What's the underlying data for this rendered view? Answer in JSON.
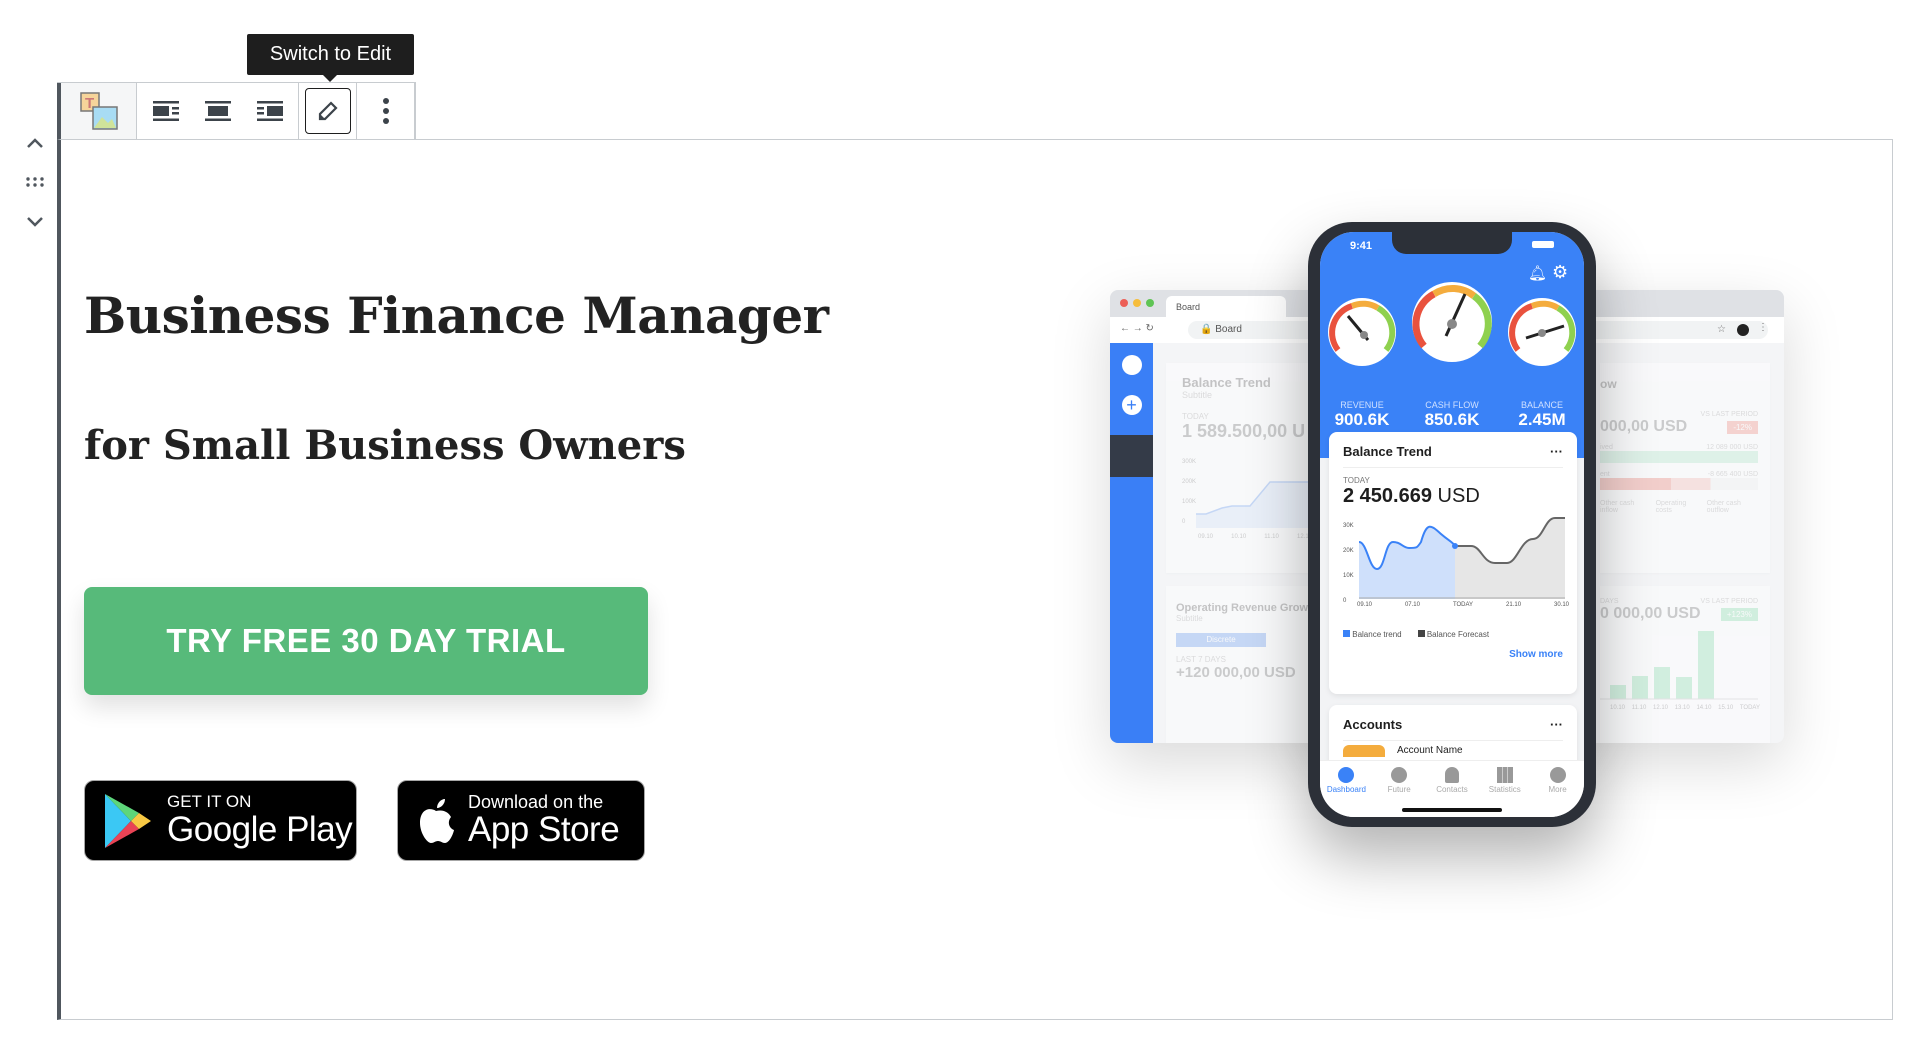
{
  "tooltip": "Switch to Edit",
  "toolbar": {
    "block_type": "media-text-icon",
    "buttons": [
      "Show media on left",
      "Wide width",
      "Show media on right",
      "Switch to Edit",
      "More options"
    ]
  },
  "hero": {
    "title": "Business Finance Manager",
    "subtitle": "for Small Business Owners",
    "cta": "TRY FREE 30 DAY TRIAL",
    "cta_color": "#57ba7a",
    "google_play": {
      "small": "GET IT ON",
      "big": "Google Play"
    },
    "app_store": {
      "small": "Download on the",
      "big": "App Store"
    }
  },
  "browser": {
    "tab": "Board",
    "address": "Board",
    "left_card": {
      "title": "Balance Trend",
      "subtitle": "Subtitle",
      "label": "TODAY",
      "value": "1 589.500,00 U",
      "yticks": [
        "300K",
        "200K",
        "100K",
        "0"
      ],
      "xticks": [
        "09.10",
        "10.10",
        "11.10",
        "12.10"
      ]
    },
    "left_card2": {
      "title": "Operating Revenue Grow",
      "subtitle": "Subtitle",
      "toggle": "Discrete",
      "label": "LAST 7 DAYS",
      "value": "+120 000,00 USD"
    },
    "right_card": {
      "title": "ow",
      "label": "VS LAST PERIOD",
      "value": "000,00 USD",
      "badge": "-12%",
      "row1_label": "ived",
      "row1_value": "12 089 000 USD",
      "row2_label": "ent",
      "row2_value": "-8 665 400 USD",
      "legend": [
        "Other cash inflow",
        "Operating costs",
        "Other cash outflow"
      ]
    },
    "right_card2": {
      "label": "VS LAST PERIOD",
      "days": "DAYS",
      "value": "0 000,00 USD",
      "badge": "+123%",
      "xticks": [
        "10.10",
        "11.10",
        "12.10",
        "13.10",
        "14.10",
        "15.10",
        "TODAY"
      ]
    }
  },
  "phone": {
    "time": "9:41",
    "gauges": [
      {
        "label": "REVENUE",
        "value": "900.6K"
      },
      {
        "label": "CASH FLOW",
        "value": "850.6K"
      },
      {
        "label": "BALANCE",
        "value": "2.45M"
      }
    ],
    "balance_card": {
      "title": "Balance Trend",
      "label": "TODAY",
      "value": "2 450.669",
      "unit": "USD",
      "yticks": [
        "30K",
        "20K",
        "10K",
        "0"
      ],
      "xticks": [
        "09.10",
        "07.10",
        "TODAY",
        "21.10",
        "30.10"
      ],
      "legend": [
        "Balance trend",
        "Balance Forecast"
      ],
      "show_more": "Show more"
    },
    "accounts": {
      "title": "Accounts",
      "item": "Account Name"
    },
    "tabs": [
      "Dashboard",
      "Future",
      "Contacts",
      "Statistics",
      "More"
    ]
  }
}
